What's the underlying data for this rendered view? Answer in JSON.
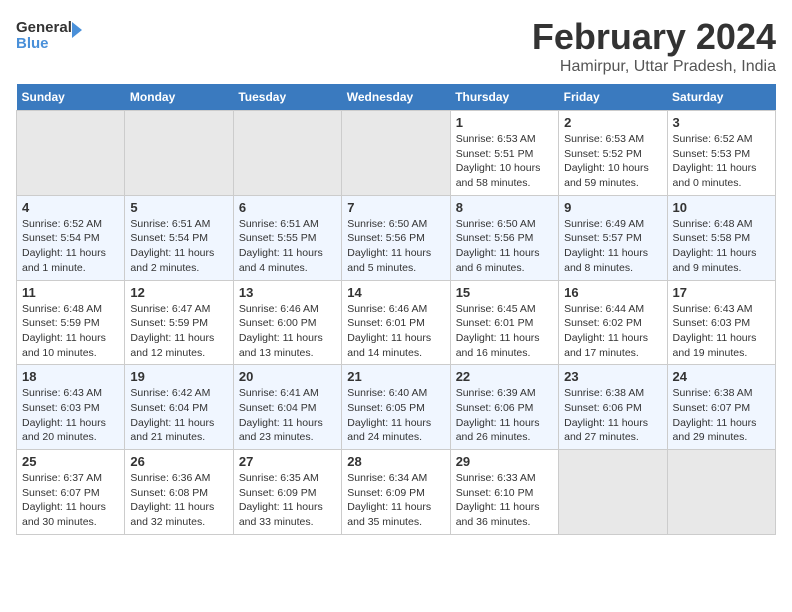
{
  "logo": {
    "line1": "General",
    "line2": "Blue"
  },
  "title": "February 2024",
  "subtitle": "Hamirpur, Uttar Pradesh, India",
  "days_of_week": [
    "Sunday",
    "Monday",
    "Tuesday",
    "Wednesday",
    "Thursday",
    "Friday",
    "Saturday"
  ],
  "weeks": [
    [
      {
        "day": "",
        "info": "",
        "empty": true
      },
      {
        "day": "",
        "info": "",
        "empty": true
      },
      {
        "day": "",
        "info": "",
        "empty": true
      },
      {
        "day": "",
        "info": "",
        "empty": true
      },
      {
        "day": "1",
        "info": "Sunrise: 6:53 AM\nSunset: 5:51 PM\nDaylight: 10 hours\nand 58 minutes."
      },
      {
        "day": "2",
        "info": "Sunrise: 6:53 AM\nSunset: 5:52 PM\nDaylight: 10 hours\nand 59 minutes."
      },
      {
        "day": "3",
        "info": "Sunrise: 6:52 AM\nSunset: 5:53 PM\nDaylight: 11 hours\nand 0 minutes."
      }
    ],
    [
      {
        "day": "4",
        "info": "Sunrise: 6:52 AM\nSunset: 5:54 PM\nDaylight: 11 hours\nand 1 minute."
      },
      {
        "day": "5",
        "info": "Sunrise: 6:51 AM\nSunset: 5:54 PM\nDaylight: 11 hours\nand 2 minutes."
      },
      {
        "day": "6",
        "info": "Sunrise: 6:51 AM\nSunset: 5:55 PM\nDaylight: 11 hours\nand 4 minutes."
      },
      {
        "day": "7",
        "info": "Sunrise: 6:50 AM\nSunset: 5:56 PM\nDaylight: 11 hours\nand 5 minutes."
      },
      {
        "day": "8",
        "info": "Sunrise: 6:50 AM\nSunset: 5:56 PM\nDaylight: 11 hours\nand 6 minutes."
      },
      {
        "day": "9",
        "info": "Sunrise: 6:49 AM\nSunset: 5:57 PM\nDaylight: 11 hours\nand 8 minutes."
      },
      {
        "day": "10",
        "info": "Sunrise: 6:48 AM\nSunset: 5:58 PM\nDaylight: 11 hours\nand 9 minutes."
      }
    ],
    [
      {
        "day": "11",
        "info": "Sunrise: 6:48 AM\nSunset: 5:59 PM\nDaylight: 11 hours\nand 10 minutes."
      },
      {
        "day": "12",
        "info": "Sunrise: 6:47 AM\nSunset: 5:59 PM\nDaylight: 11 hours\nand 12 minutes."
      },
      {
        "day": "13",
        "info": "Sunrise: 6:46 AM\nSunset: 6:00 PM\nDaylight: 11 hours\nand 13 minutes."
      },
      {
        "day": "14",
        "info": "Sunrise: 6:46 AM\nSunset: 6:01 PM\nDaylight: 11 hours\nand 14 minutes."
      },
      {
        "day": "15",
        "info": "Sunrise: 6:45 AM\nSunset: 6:01 PM\nDaylight: 11 hours\nand 16 minutes."
      },
      {
        "day": "16",
        "info": "Sunrise: 6:44 AM\nSunset: 6:02 PM\nDaylight: 11 hours\nand 17 minutes."
      },
      {
        "day": "17",
        "info": "Sunrise: 6:43 AM\nSunset: 6:03 PM\nDaylight: 11 hours\nand 19 minutes."
      }
    ],
    [
      {
        "day": "18",
        "info": "Sunrise: 6:43 AM\nSunset: 6:03 PM\nDaylight: 11 hours\nand 20 minutes."
      },
      {
        "day": "19",
        "info": "Sunrise: 6:42 AM\nSunset: 6:04 PM\nDaylight: 11 hours\nand 21 minutes."
      },
      {
        "day": "20",
        "info": "Sunrise: 6:41 AM\nSunset: 6:04 PM\nDaylight: 11 hours\nand 23 minutes."
      },
      {
        "day": "21",
        "info": "Sunrise: 6:40 AM\nSunset: 6:05 PM\nDaylight: 11 hours\nand 24 minutes."
      },
      {
        "day": "22",
        "info": "Sunrise: 6:39 AM\nSunset: 6:06 PM\nDaylight: 11 hours\nand 26 minutes."
      },
      {
        "day": "23",
        "info": "Sunrise: 6:38 AM\nSunset: 6:06 PM\nDaylight: 11 hours\nand 27 minutes."
      },
      {
        "day": "24",
        "info": "Sunrise: 6:38 AM\nSunset: 6:07 PM\nDaylight: 11 hours\nand 29 minutes."
      }
    ],
    [
      {
        "day": "25",
        "info": "Sunrise: 6:37 AM\nSunset: 6:07 PM\nDaylight: 11 hours\nand 30 minutes."
      },
      {
        "day": "26",
        "info": "Sunrise: 6:36 AM\nSunset: 6:08 PM\nDaylight: 11 hours\nand 32 minutes."
      },
      {
        "day": "27",
        "info": "Sunrise: 6:35 AM\nSunset: 6:09 PM\nDaylight: 11 hours\nand 33 minutes."
      },
      {
        "day": "28",
        "info": "Sunrise: 6:34 AM\nSunset: 6:09 PM\nDaylight: 11 hours\nand 35 minutes."
      },
      {
        "day": "29",
        "info": "Sunrise: 6:33 AM\nSunset: 6:10 PM\nDaylight: 11 hours\nand 36 minutes."
      },
      {
        "day": "",
        "info": "",
        "empty": true
      },
      {
        "day": "",
        "info": "",
        "empty": true
      }
    ]
  ]
}
